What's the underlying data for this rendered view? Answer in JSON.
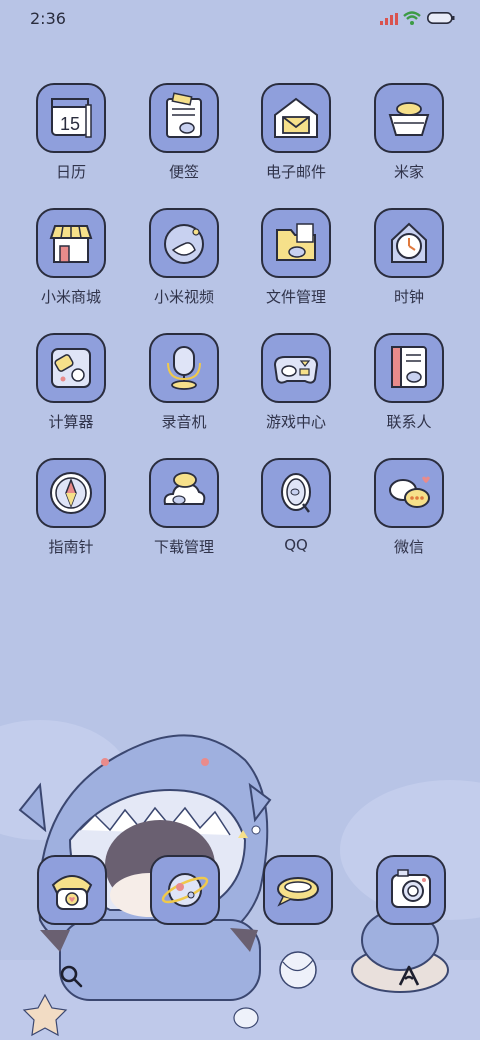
{
  "status": {
    "time": "2:36"
  },
  "apps": [
    {
      "label": "日历",
      "icon": "calendar-icon",
      "day": "15"
    },
    {
      "label": "便签",
      "icon": "notes-icon"
    },
    {
      "label": "电子邮件",
      "icon": "email-icon"
    },
    {
      "label": "米家",
      "icon": "mihome-icon"
    },
    {
      "label": "小米商城",
      "icon": "store-icon"
    },
    {
      "label": "小米视频",
      "icon": "video-icon"
    },
    {
      "label": "文件管理",
      "icon": "file-manager-icon"
    },
    {
      "label": "时钟",
      "icon": "clock-icon"
    },
    {
      "label": "计算器",
      "icon": "calculator-icon"
    },
    {
      "label": "录音机",
      "icon": "recorder-icon"
    },
    {
      "label": "游戏中心",
      "icon": "game-center-icon"
    },
    {
      "label": "联系人",
      "icon": "contacts-icon"
    },
    {
      "label": "指南针",
      "icon": "compass-icon"
    },
    {
      "label": "下载管理",
      "icon": "downloads-icon"
    },
    {
      "label": "QQ",
      "icon": "qq-icon"
    },
    {
      "label": "微信",
      "icon": "wechat-icon"
    }
  ],
  "dock": [
    {
      "icon": "phone-icon"
    },
    {
      "icon": "browser-icon"
    },
    {
      "icon": "messages-icon"
    },
    {
      "icon": "camera-icon"
    }
  ],
  "colors": {
    "background": "#b8c4e6",
    "tile": "#8f9fdc",
    "outline": "#2a2d3e",
    "accent_yellow": "#f6e08a"
  }
}
